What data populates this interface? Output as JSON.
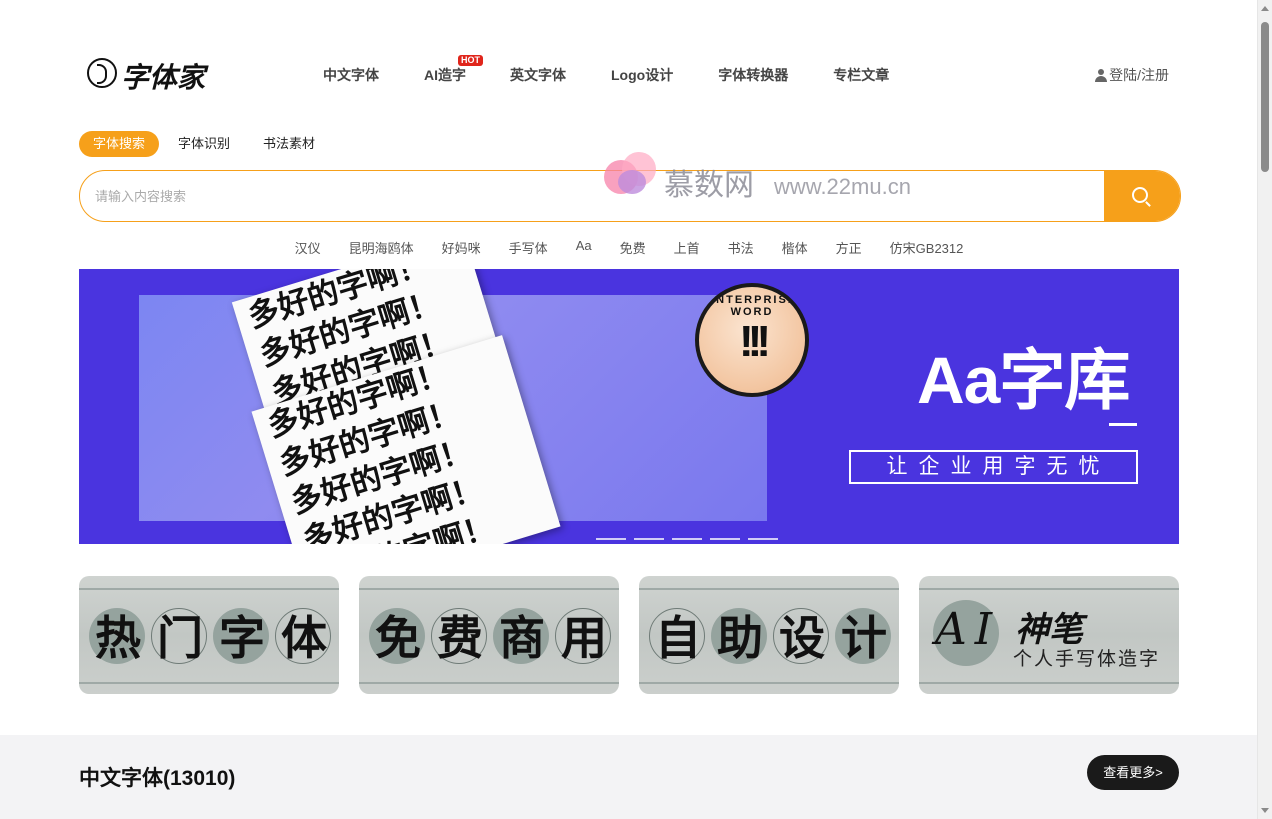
{
  "header": {
    "logo_text": "字体家",
    "nav": [
      {
        "label": "中文字体"
      },
      {
        "label": "AI造字",
        "badge": "HOT"
      },
      {
        "label": "英文字体"
      },
      {
        "label": "Logo设计"
      },
      {
        "label": "字体转换器"
      },
      {
        "label": "专栏文章"
      }
    ],
    "login_label": "登陆/注册"
  },
  "search": {
    "tabs": [
      "字体搜索",
      "字体识别",
      "书法素材"
    ],
    "active_tab": 0,
    "placeholder": "请输入内容搜索",
    "hot_words": [
      "汉仪",
      "昆明海鸥体",
      "好妈咪",
      "手写体",
      "Aa",
      "免费",
      "上首",
      "书法",
      "楷体",
      "方正",
      "仿宋GB2312"
    ]
  },
  "watermark": {
    "name": "慕数网",
    "url": "www.22mu.cn"
  },
  "banner": {
    "headline": "Aa字库",
    "tagline": "让企业用字无忧",
    "badge_text": "ENTERPRISE WORD",
    "badge_mark": "!!!",
    "paper_lines": [
      "多好的字啊！",
      "多好的字啊！",
      "多好的字啊！",
      "多好的字啊！",
      "多好的字啊！",
      "多好的字啊！",
      "多好的字啊！",
      "多好的字啊！"
    ],
    "slide_count": 5
  },
  "cards": [
    {
      "chars": [
        "热",
        "门",
        "字",
        "体"
      ]
    },
    {
      "chars": [
        "免",
        "费",
        "商",
        "用"
      ]
    },
    {
      "chars": [
        "自",
        "助",
        "设",
        "计"
      ]
    },
    {
      "ai_mark": "AI",
      "title": "神笔",
      "subtitle": "个人手写体造字"
    }
  ],
  "section": {
    "title": "中文字体(13010)",
    "more_label": "查看更多>"
  },
  "colors": {
    "accent": "#f6a01a",
    "banner_bg": "#4a34df",
    "hot_badge": "#e0251b"
  }
}
